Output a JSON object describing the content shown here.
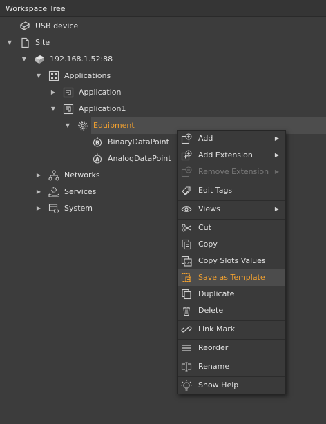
{
  "header": {
    "title": "Workspace Tree"
  },
  "tree": {
    "usb": "USB device",
    "site": "Site",
    "host": "192.168.1.52:88",
    "applications": "Applications",
    "application": "Application",
    "application1": "Application1",
    "equipment": "Equipment",
    "binary": "BinaryDataPoint",
    "analog": "AnalogDataPoint",
    "networks": "Networks",
    "services": "Services",
    "system": "System"
  },
  "menu": {
    "add": "Add",
    "add_extension": "Add Extension",
    "remove_extension": "Remove Extension",
    "edit_tags": "Edit Tags",
    "views": "Views",
    "cut": "Cut",
    "copy": "Copy",
    "copy_slots": "Copy Slots Values",
    "save_template": "Save as Template",
    "duplicate": "Duplicate",
    "delete": "Delete",
    "link_mark": "Link Mark",
    "reorder": "Reorder",
    "rename": "Rename",
    "show_help": "Show Help"
  },
  "colors": {
    "accent": "#f0a030",
    "background": "#3c3c3c",
    "selection": "#4d4d4d"
  }
}
